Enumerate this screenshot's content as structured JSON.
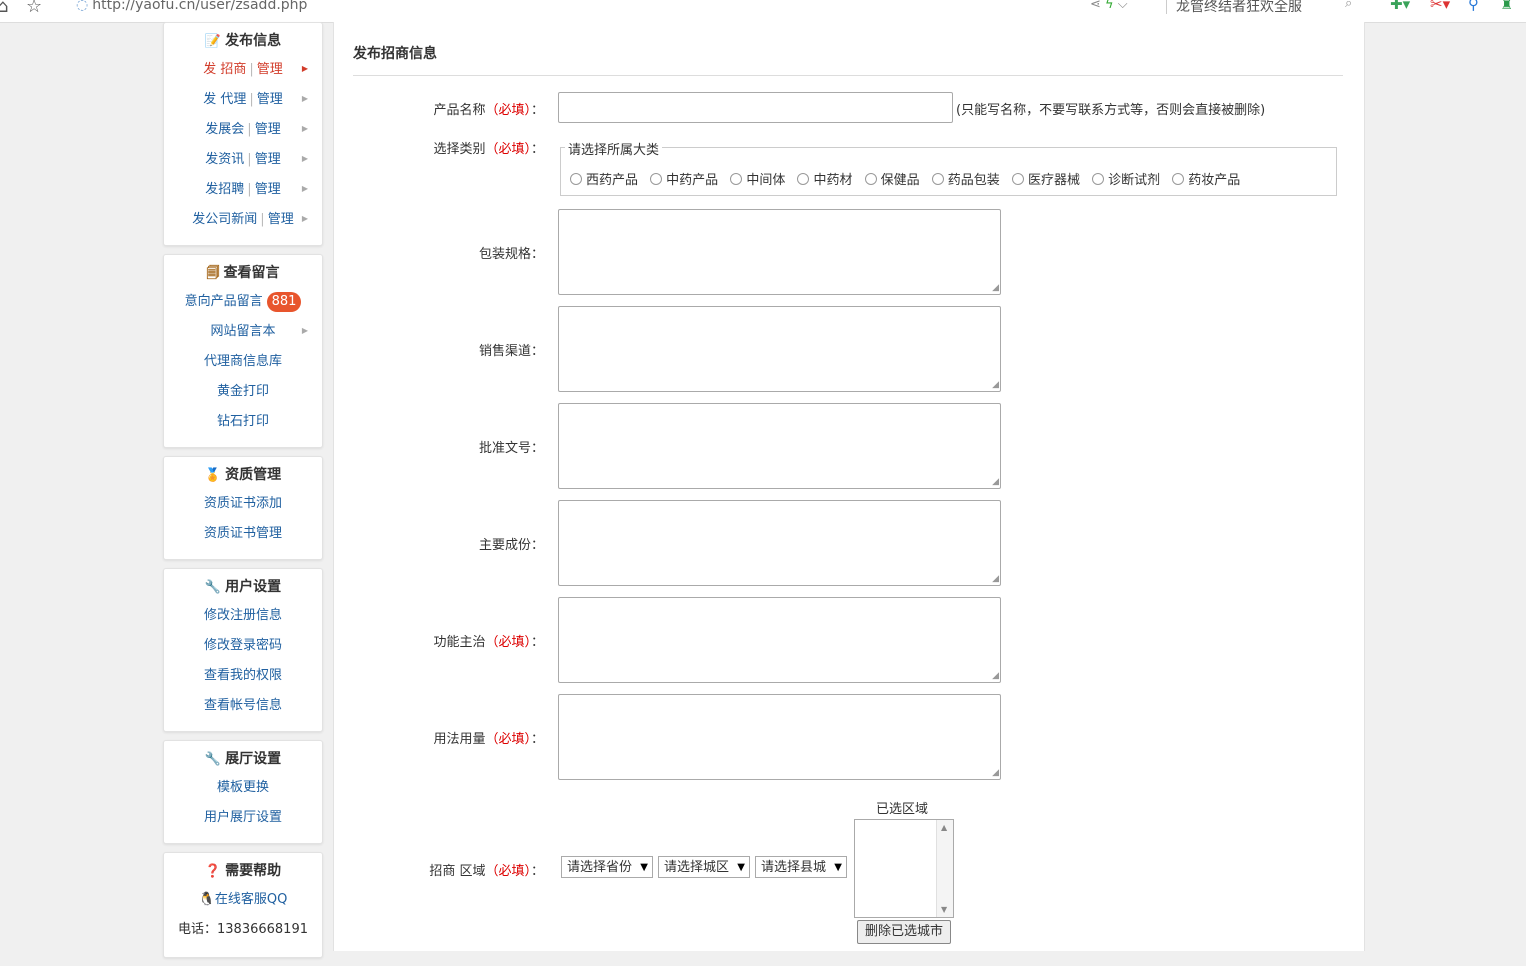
{
  "browser": {
    "url": "http://yaofu.cn/user/zsadd.php",
    "search_text": "龙管终结者狂欢全服",
    "nav_back": "⌂",
    "nav_star": "☆"
  },
  "sidebar": {
    "publish": {
      "title": "发布信息",
      "items": [
        {
          "label": "发 招商",
          "manage": "管理"
        },
        {
          "label": "发 代理",
          "manage": "管理"
        },
        {
          "label": "发展会",
          "manage": "管理"
        },
        {
          "label": "发资讯",
          "manage": "管理"
        },
        {
          "label": "发招聘",
          "manage": "管理"
        },
        {
          "label": "发公司新闻",
          "manage": "管理"
        }
      ]
    },
    "messages": {
      "title": "查看留言",
      "items": [
        {
          "label": "意向产品留言",
          "badge": "881"
        },
        {
          "label": "网站留言本"
        },
        {
          "label": "代理商信息库"
        },
        {
          "label": "黄金打印"
        },
        {
          "label": "钻石打印"
        }
      ]
    },
    "qualification": {
      "title": "资质管理",
      "items": [
        {
          "label": "资质证书添加"
        },
        {
          "label": "资质证书管理"
        }
      ]
    },
    "user_settings": {
      "title": "用户设置",
      "items": [
        {
          "label": "修改注册信息"
        },
        {
          "label": "修改登录密码"
        },
        {
          "label": "查看我的权限"
        },
        {
          "label": "查看帐号信息"
        }
      ]
    },
    "hall_settings": {
      "title": "展厅设置",
      "items": [
        {
          "label": "模板更换"
        },
        {
          "label": "用户展厅设置"
        }
      ]
    },
    "help": {
      "title": "需要帮助",
      "qq": "在线客服QQ",
      "phone": "电话：13836668191"
    }
  },
  "form": {
    "title": "发布招商信息",
    "product_name": {
      "label": "产品名称",
      "required": "（必填）",
      "colon": "：",
      "value": "",
      "hint": "(只能写名称，不要写联系方式等，否则会直接被删除)"
    },
    "category": {
      "label": "选择类别",
      "required": "（必填）",
      "colon": "：",
      "legend": "请选择所属大类",
      "options": [
        "西药产品",
        "中药产品",
        "中间体",
        "中药材",
        "保健品",
        "药品包装",
        "医疗器械",
        "诊断试剂",
        "药妆产品"
      ]
    },
    "packaging": {
      "label": "包装规格",
      "colon": "：",
      "value": ""
    },
    "sales_channel": {
      "label": "销售渠道",
      "colon": "：",
      "value": ""
    },
    "approval_no": {
      "label": "批准文号",
      "colon": "：",
      "value": ""
    },
    "ingredients": {
      "label": "主要成份",
      "colon": "：",
      "value": ""
    },
    "indications": {
      "label": "功能主治",
      "required": "（必填）",
      "colon": "：",
      "value": ""
    },
    "usage": {
      "label": "用法用量",
      "required": "（必填）",
      "colon": "：",
      "value": ""
    },
    "region": {
      "label": "招商 区域",
      "required": "（必填）",
      "colon": "：",
      "province": "请选择省份",
      "city": "请选择城区",
      "county": "请选择县城",
      "selected_title": "已选区域",
      "delete_button": "删除已选城市"
    }
  }
}
